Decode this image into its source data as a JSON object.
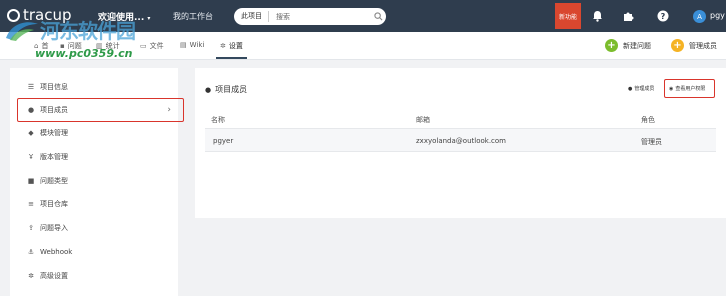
{
  "topbar": {
    "logo": "tracup",
    "project_switch": "欢迎使用...",
    "my_workbench": "我的工作台",
    "search_scope": "此项目",
    "search_placeholder": "搜索",
    "new_feature": "新功能",
    "username": "pgy"
  },
  "subnav": {
    "tabs": [
      {
        "label": "首",
        "icon": "home-icon"
      },
      {
        "label": "问题",
        "icon": "issue-icon"
      },
      {
        "label": "统计",
        "icon": "stats-icon"
      },
      {
        "label": "文件",
        "icon": "file-icon"
      },
      {
        "label": "Wiki",
        "icon": "wiki-icon"
      },
      {
        "label": "设置",
        "icon": "gear-icon"
      }
    ],
    "new_issue": "新建问题",
    "manage_members": "管理成员"
  },
  "sidebar": {
    "items": [
      {
        "label": "项目信息"
      },
      {
        "label": "项目成员"
      },
      {
        "label": "模块管理"
      },
      {
        "label": "版本管理"
      },
      {
        "label": "问题类型"
      },
      {
        "label": "项目仓库"
      },
      {
        "label": "问题导入"
      },
      {
        "label": "Webhook"
      },
      {
        "label": "高级设置"
      }
    ]
  },
  "panel": {
    "title": "项目成员",
    "manage_members_btn": "管理成员",
    "view_permissions_btn": "查看用户权限",
    "columns": [
      "名称",
      "邮箱",
      "角色"
    ],
    "rows": [
      {
        "name": "pgyer",
        "email": "zxxyolanda@outlook.com",
        "role": "管理员"
      }
    ]
  },
  "watermark": {
    "han": "河东软件园",
    "url": "www.pc0359.cn"
  },
  "colors": {
    "topbar": "#2f3d4e",
    "accent_red": "#d9352c",
    "new_issue_green": "#7cbd2d",
    "manage_yellow": "#f5b324"
  }
}
